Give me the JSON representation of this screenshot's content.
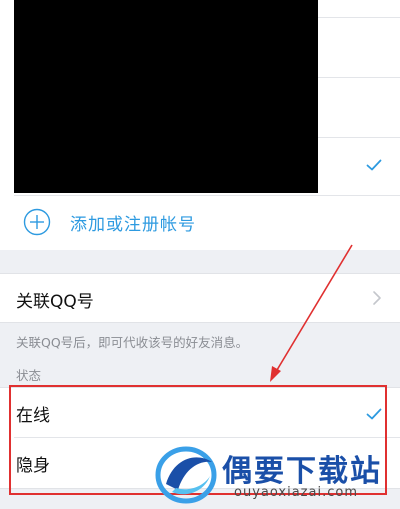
{
  "accounts": {
    "add_account_label": "添加或注册帐号"
  },
  "associated_qq": {
    "label": "关联QQ号",
    "hint": "关联QQ号后，即可代收该号的好友消息。"
  },
  "status": {
    "header": "状态",
    "options": [
      {
        "label": "在线",
        "selected": true
      },
      {
        "label": "隐身",
        "selected": false
      }
    ]
  },
  "watermark": {
    "title": "偶要下载站",
    "domain": "ouyaoxiazai.com"
  },
  "colors": {
    "accent": "#2d9ae0",
    "annotation": "#e03030",
    "watermark_blue": "#1a4fa8"
  },
  "icons": {
    "check": "check-icon",
    "add": "plus-circle-icon",
    "chevron": "chevron-right-icon"
  }
}
